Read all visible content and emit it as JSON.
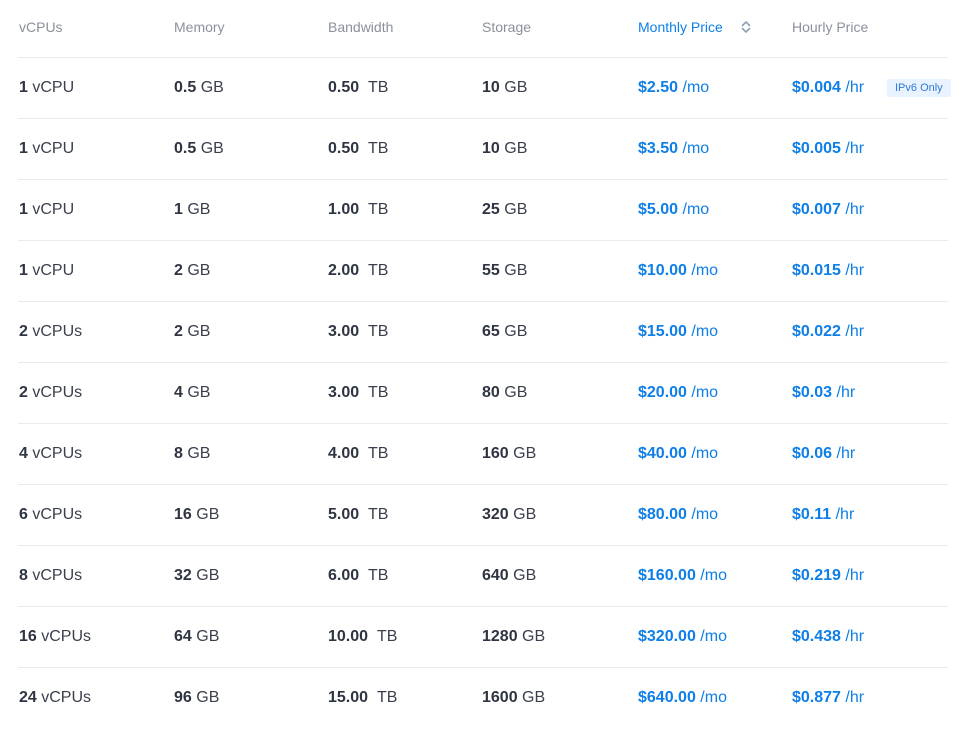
{
  "headers": {
    "vcpus": "vCPUs",
    "memory": "Memory",
    "bandwidth": "Bandwidth",
    "storage": "Storage",
    "monthly_price": "Monthly Price",
    "hourly_price": "Hourly Price"
  },
  "rows": [
    {
      "vcpus_value": "1",
      "vcpus_unit": "vCPU",
      "memory_value": "0.5",
      "memory_unit": "GB",
      "bandwidth_value": "0.50",
      "bandwidth_unit": "TB",
      "storage_value": "10",
      "storage_unit": "GB",
      "monthly_value": "$2.50",
      "monthly_unit": "/mo",
      "hourly_value": "$0.004",
      "hourly_unit": "/hr",
      "badge": "IPv6 Only"
    },
    {
      "vcpus_value": "1",
      "vcpus_unit": "vCPU",
      "memory_value": "0.5",
      "memory_unit": "GB",
      "bandwidth_value": "0.50",
      "bandwidth_unit": "TB",
      "storage_value": "10",
      "storage_unit": "GB",
      "monthly_value": "$3.50",
      "monthly_unit": "/mo",
      "hourly_value": "$0.005",
      "hourly_unit": "/hr"
    },
    {
      "vcpus_value": "1",
      "vcpus_unit": "vCPU",
      "memory_value": "1",
      "memory_unit": "GB",
      "bandwidth_value": "1.00",
      "bandwidth_unit": "TB",
      "storage_value": "25",
      "storage_unit": "GB",
      "monthly_value": "$5.00",
      "monthly_unit": "/mo",
      "hourly_value": "$0.007",
      "hourly_unit": "/hr"
    },
    {
      "vcpus_value": "1",
      "vcpus_unit": "vCPU",
      "memory_value": "2",
      "memory_unit": "GB",
      "bandwidth_value": "2.00",
      "bandwidth_unit": "TB",
      "storage_value": "55",
      "storage_unit": "GB",
      "monthly_value": "$10.00",
      "monthly_unit": "/mo",
      "hourly_value": "$0.015",
      "hourly_unit": "/hr"
    },
    {
      "vcpus_value": "2",
      "vcpus_unit": "vCPUs",
      "memory_value": "2",
      "memory_unit": "GB",
      "bandwidth_value": "3.00",
      "bandwidth_unit": "TB",
      "storage_value": "65",
      "storage_unit": "GB",
      "monthly_value": "$15.00",
      "monthly_unit": "/mo",
      "hourly_value": "$0.022",
      "hourly_unit": "/hr"
    },
    {
      "vcpus_value": "2",
      "vcpus_unit": "vCPUs",
      "memory_value": "4",
      "memory_unit": "GB",
      "bandwidth_value": "3.00",
      "bandwidth_unit": "TB",
      "storage_value": "80",
      "storage_unit": "GB",
      "monthly_value": "$20.00",
      "monthly_unit": "/mo",
      "hourly_value": "$0.03",
      "hourly_unit": "/hr"
    },
    {
      "vcpus_value": "4",
      "vcpus_unit": "vCPUs",
      "memory_value": "8",
      "memory_unit": "GB",
      "bandwidth_value": "4.00",
      "bandwidth_unit": "TB",
      "storage_value": "160",
      "storage_unit": "GB",
      "monthly_value": "$40.00",
      "monthly_unit": "/mo",
      "hourly_value": "$0.06",
      "hourly_unit": "/hr"
    },
    {
      "vcpus_value": "6",
      "vcpus_unit": "vCPUs",
      "memory_value": "16",
      "memory_unit": "GB",
      "bandwidth_value": "5.00",
      "bandwidth_unit": "TB",
      "storage_value": "320",
      "storage_unit": "GB",
      "monthly_value": "$80.00",
      "monthly_unit": "/mo",
      "hourly_value": "$0.11",
      "hourly_unit": "/hr"
    },
    {
      "vcpus_value": "8",
      "vcpus_unit": "vCPUs",
      "memory_value": "32",
      "memory_unit": "GB",
      "bandwidth_value": "6.00",
      "bandwidth_unit": "TB",
      "storage_value": "640",
      "storage_unit": "GB",
      "monthly_value": "$160.00",
      "monthly_unit": "/mo",
      "hourly_value": "$0.219",
      "hourly_unit": "/hr"
    },
    {
      "vcpus_value": "16",
      "vcpus_unit": "vCPUs",
      "memory_value": "64",
      "memory_unit": "GB",
      "bandwidth_value": "10.00",
      "bandwidth_unit": "TB",
      "storage_value": "1280",
      "storage_unit": "GB",
      "monthly_value": "$320.00",
      "monthly_unit": "/mo",
      "hourly_value": "$0.438",
      "hourly_unit": "/hr"
    },
    {
      "vcpus_value": "24",
      "vcpus_unit": "vCPUs",
      "memory_value": "96",
      "memory_unit": "GB",
      "bandwidth_value": "15.00",
      "bandwidth_unit": "TB",
      "storage_value": "1600",
      "storage_unit": "GB",
      "monthly_value": "$640.00",
      "monthly_unit": "/mo",
      "hourly_value": "$0.877",
      "hourly_unit": "/hr"
    }
  ],
  "icons": {
    "sort": "sort-icon"
  },
  "colors": {
    "accent": "#0e7ee8",
    "header_text": "#8b909b",
    "body_text": "#2f3442",
    "divider": "#e8eaee",
    "badge_bg": "#e9f2ff",
    "badge_text": "#2f7ad7"
  }
}
